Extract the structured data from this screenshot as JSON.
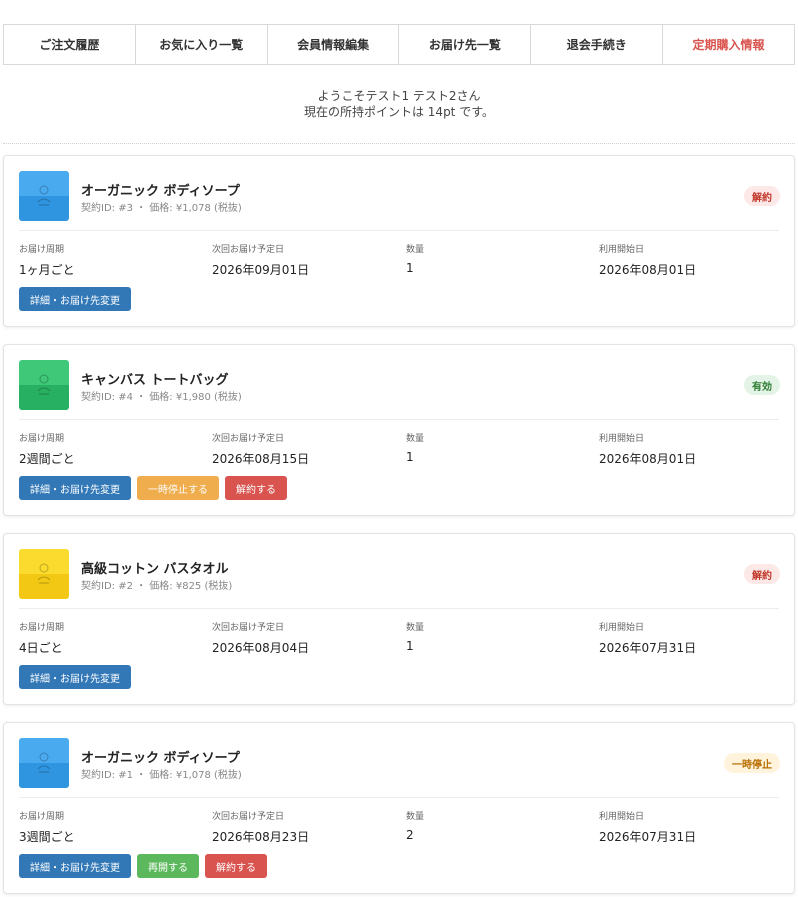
{
  "tabs": [
    {
      "label": "ご注文履歴",
      "active": false
    },
    {
      "label": "お気に入り一覧",
      "active": false
    },
    {
      "label": "会員情報編集",
      "active": false
    },
    {
      "label": "お届け先一覧",
      "active": false
    },
    {
      "label": "退会手続き",
      "active": false
    },
    {
      "label": "定期購入情報",
      "active": true
    }
  ],
  "welcome": {
    "line1": "ようこそテスト1 テスト2さん",
    "line2": "現在の所持ポイントは 14pt です。"
  },
  "labels": {
    "cycle": "お届け周期",
    "next_date": "次回お届け予定日",
    "quantity": "数量",
    "start_date": "利用開始日"
  },
  "colors": {
    "accent_tab": "#d9534f",
    "btn_detail": "#3278b7",
    "btn_pause": "#efad4e",
    "btn_cancel": "#d9534f",
    "btn_resume": "#5cb85c"
  },
  "subscriptions": [
    {
      "name": "オーガニック ボディソープ",
      "meta": "契約ID: #3 ・ 価格: ¥1,078 (税抜)",
      "status": "解約",
      "status_type": "cancelled",
      "thumb_top": "#4aaaf0",
      "thumb_bottom": "#2f95e0",
      "cycle": "1ヶ月ごと",
      "next_date": "2026年09月01日",
      "quantity": "1",
      "start_date": "2026年08月01日",
      "buttons": [
        {
          "label": "詳細・お届け先変更",
          "type": "blue"
        }
      ]
    },
    {
      "name": "キャンバス トートバッグ",
      "meta": "契約ID: #4 ・ 価格: ¥1,980 (税抜)",
      "status": "有効",
      "status_type": "active",
      "thumb_top": "#3ec878",
      "thumb_bottom": "#27b062",
      "cycle": "2週間ごと",
      "next_date": "2026年08月15日",
      "quantity": "1",
      "start_date": "2026年08月01日",
      "buttons": [
        {
          "label": "詳細・お届け先変更",
          "type": "blue"
        },
        {
          "label": "一時停止する",
          "type": "orange"
        },
        {
          "label": "解約する",
          "type": "red"
        }
      ]
    },
    {
      "name": "高級コットン バスタオル",
      "meta": "契約ID: #2 ・ 価格: ¥825 (税抜)",
      "status": "解約",
      "status_type": "cancelled",
      "thumb_top": "#fbdc2e",
      "thumb_bottom": "#f2c814",
      "cycle": "4日ごと",
      "next_date": "2026年08月04日",
      "quantity": "1",
      "start_date": "2026年07月31日",
      "buttons": [
        {
          "label": "詳細・お届け先変更",
          "type": "blue"
        }
      ]
    },
    {
      "name": "オーガニック ボディソープ",
      "meta": "契約ID: #1 ・ 価格: ¥1,078 (税抜)",
      "status": "一時停止",
      "status_type": "paused",
      "thumb_top": "#4aaaf0",
      "thumb_bottom": "#2f95e0",
      "cycle": "3週間ごと",
      "next_date": "2026年08月23日",
      "quantity": "2",
      "start_date": "2026年07月31日",
      "buttons": [
        {
          "label": "詳細・お届け先変更",
          "type": "blue"
        },
        {
          "label": "再開する",
          "type": "green"
        },
        {
          "label": "解約する",
          "type": "red"
        }
      ]
    }
  ]
}
